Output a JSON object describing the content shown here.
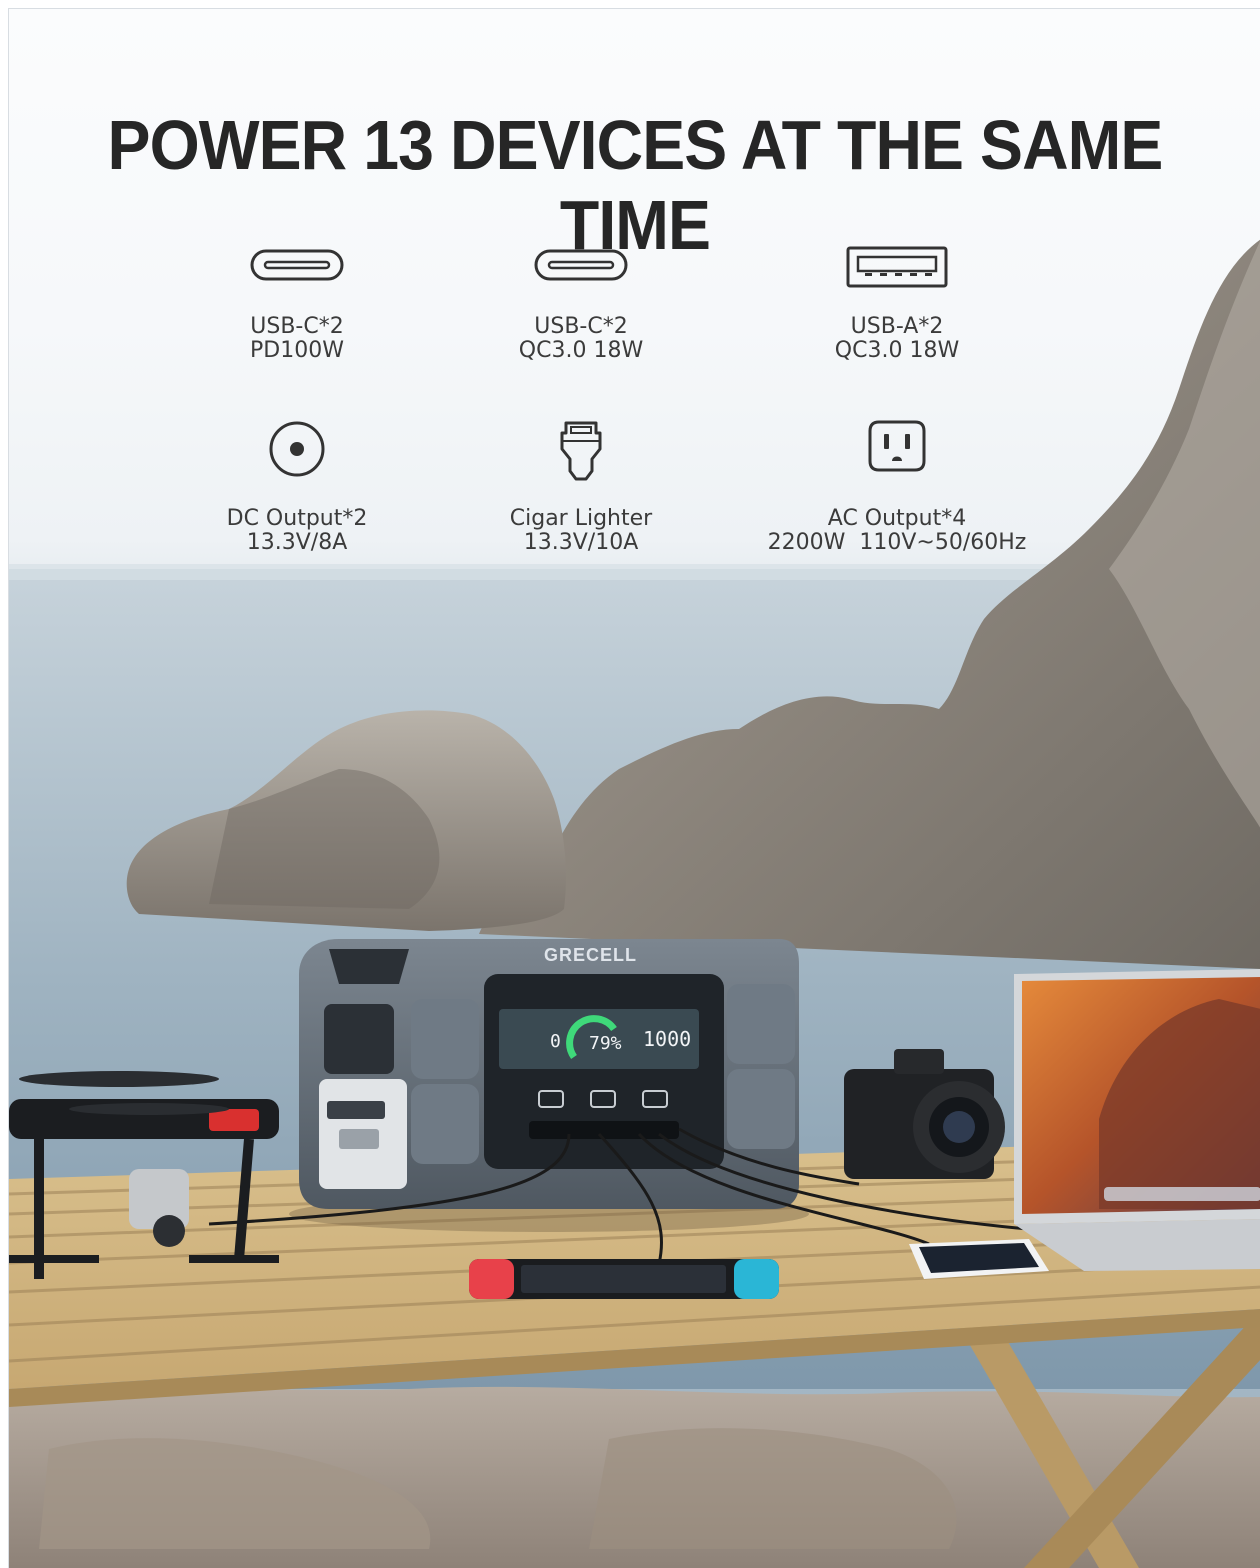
{
  "headline": "POWER 13 DEVICES AT THE SAME TIME",
  "brand": "GRECELL",
  "ports": [
    {
      "icon": "usb-c-port-icon",
      "line1": "USB-C*2",
      "line2": "PD100W"
    },
    {
      "icon": "usb-c-port-icon",
      "line1": "USB-C*2",
      "line2": "QC3.0 18W"
    },
    {
      "icon": "usb-a-port-icon",
      "line1": "USB-A*2",
      "line2": "QC3.0 18W"
    },
    {
      "icon": "dc-port-icon",
      "line1": "DC Output*2",
      "line2": "13.3V/8A"
    },
    {
      "icon": "car-charger-icon",
      "line1": "Cigar Lighter",
      "line2": "13.3V/10A"
    },
    {
      "icon": "ac-outlet-icon",
      "line1": "AC Output*4",
      "line2": "2200W  110V~50/60Hz"
    }
  ],
  "display": {
    "input_watts": "0",
    "battery_percent": "79%",
    "output_watts": "1000"
  },
  "colors": {
    "headline": "#262626",
    "label": "#3b3b3b",
    "station_body": "#5d6670",
    "screen": "#2f3d44",
    "battery_arc": "#3fd97a"
  }
}
